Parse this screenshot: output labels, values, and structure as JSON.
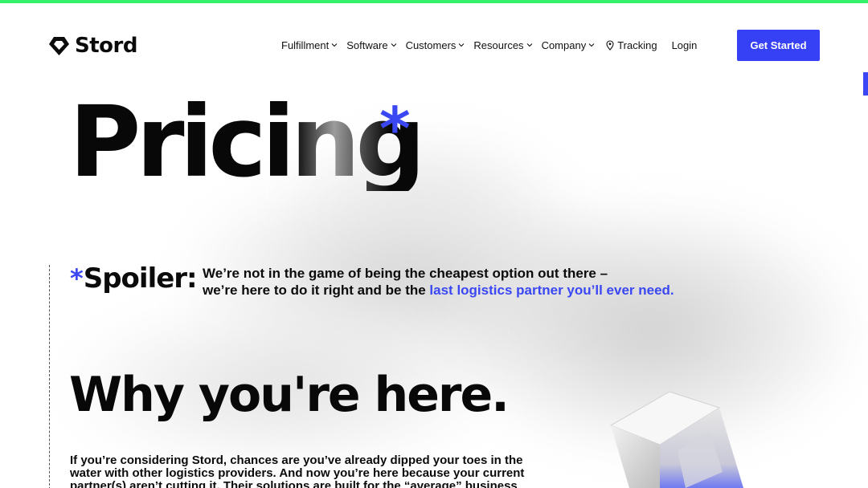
{
  "brand": {
    "name": "Stord",
    "accent": "#3640f5",
    "top_bar_color": "#34f06a"
  },
  "nav": {
    "items": [
      {
        "label": "Fulfillment",
        "has_dropdown": true
      },
      {
        "label": "Software",
        "has_dropdown": true
      },
      {
        "label": "Customers",
        "has_dropdown": true
      },
      {
        "label": "Resources",
        "has_dropdown": true
      },
      {
        "label": "Company",
        "has_dropdown": true
      }
    ],
    "tracking": {
      "label": "Tracking",
      "icon": "map-pin-icon"
    },
    "login": "Login",
    "cta": "Get Started"
  },
  "hero": {
    "title": "Pricing",
    "asterisk": "*"
  },
  "spoiler": {
    "asterisk": "*",
    "label": "Spoiler:",
    "line1": "We’re not in the game of being the cheapest option out there –",
    "line2_prefix": "we’re here to do it right and be the ",
    "line2_link": "last logistics partner you’ll ever need."
  },
  "why": {
    "title": "Why you're here.",
    "body": "If you’re considering Stord, chances are you’ve already dipped your toes in the water with other logistics providers. And now you’re here because your current partner(s) aren’t cutting it. Their solutions are built for the “average” business"
  }
}
